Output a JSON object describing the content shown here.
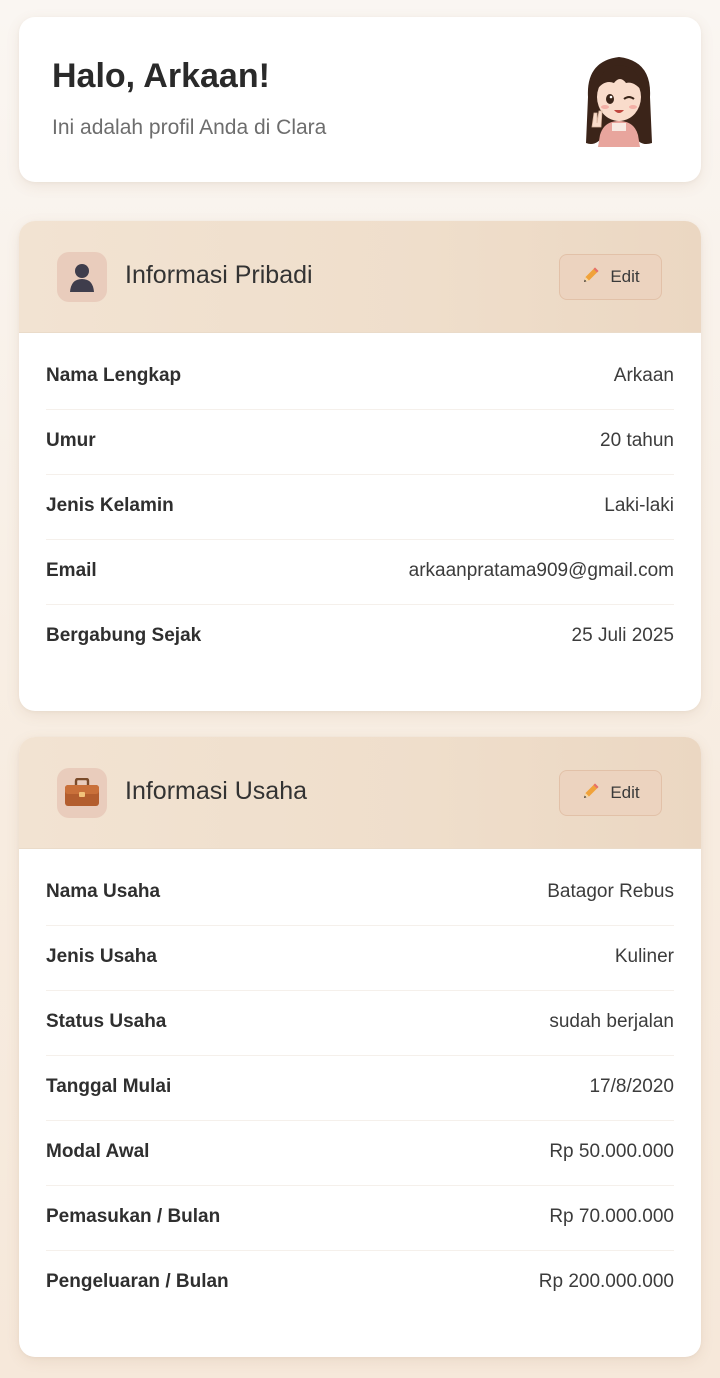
{
  "greeting": {
    "title": "Halo, Arkaan!",
    "subtitle": "Ini adalah profil Anda di Clara",
    "avatar_icon": "anime-girl-avatar"
  },
  "personal": {
    "icon": "person-silhouette-icon",
    "title": "Informasi Pribadi",
    "edit_label": "Edit",
    "rows": [
      {
        "label": "Nama Lengkap",
        "value": "Arkaan"
      },
      {
        "label": "Umur",
        "value": "20 tahun"
      },
      {
        "label": "Jenis Kelamin",
        "value": "Laki-laki"
      },
      {
        "label": "Email",
        "value": "arkaanpratama909@gmail.com"
      },
      {
        "label": "Bergabung Sejak",
        "value": "25 Juli 2025"
      }
    ]
  },
  "business": {
    "icon": "briefcase-icon",
    "title": "Informasi Usaha",
    "edit_label": "Edit",
    "rows": [
      {
        "label": "Nama Usaha",
        "value": "Batagor Rebus"
      },
      {
        "label": "Jenis Usaha",
        "value": "Kuliner"
      },
      {
        "label": "Status Usaha",
        "value": "sudah berjalan"
      },
      {
        "label": "Tanggal Mulai",
        "value": "17/8/2020"
      },
      {
        "label": "Modal Awal",
        "value": "Rp 50.000.000"
      },
      {
        "label": "Pemasukan / Bulan",
        "value": "Rp 70.000.000"
      },
      {
        "label": "Pengeluaran / Bulan",
        "value": "Rp 200.000.000"
      }
    ]
  },
  "colors": {
    "header_bg": "#efdecb",
    "edit_bg": "#ecd3bf",
    "page_bg": "#f7ece0"
  }
}
